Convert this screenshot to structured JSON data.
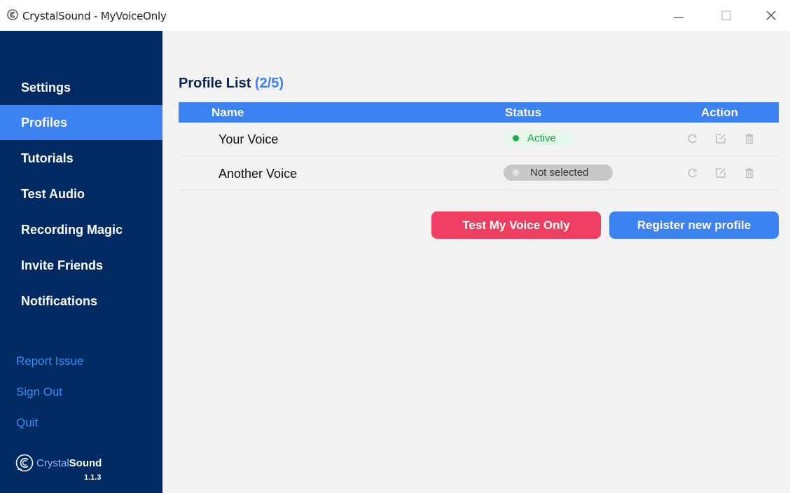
{
  "window": {
    "title": "CrystalSound - MyVoiceOnly",
    "icon": "crystalsound-logo-icon"
  },
  "sidebar": {
    "items": [
      {
        "label": "Settings",
        "active": false
      },
      {
        "label": "Profiles",
        "active": true
      },
      {
        "label": "Tutorials",
        "active": false
      },
      {
        "label": "Test Audio",
        "active": false
      },
      {
        "label": "Recording Magic",
        "active": false
      },
      {
        "label": "Invite Friends",
        "active": false
      },
      {
        "label": "Notifications",
        "active": false
      }
    ],
    "secondary": [
      {
        "label": "Report Issue"
      },
      {
        "label": "Sign Out"
      },
      {
        "label": "Quit"
      }
    ],
    "brand": {
      "name_part1": "Crystal",
      "name_part2": "Sound",
      "version": "1.1.3"
    }
  },
  "main": {
    "title": "Profile List",
    "count": "(2/5)",
    "table": {
      "headers": {
        "name": "Name",
        "status": "Status",
        "action": "Action"
      },
      "rows": [
        {
          "name": "Your Voice",
          "status": "Active"
        },
        {
          "name": "Another Voice",
          "status": "Not selected"
        }
      ]
    },
    "buttons": {
      "test": "Test My Voice Only",
      "register": "Register new profile"
    }
  },
  "colors": {
    "sidebar_bg": "#012a63",
    "accent_blue": "#3c82f0",
    "accent_red": "#ee3e62",
    "active_green": "#22a84f"
  }
}
